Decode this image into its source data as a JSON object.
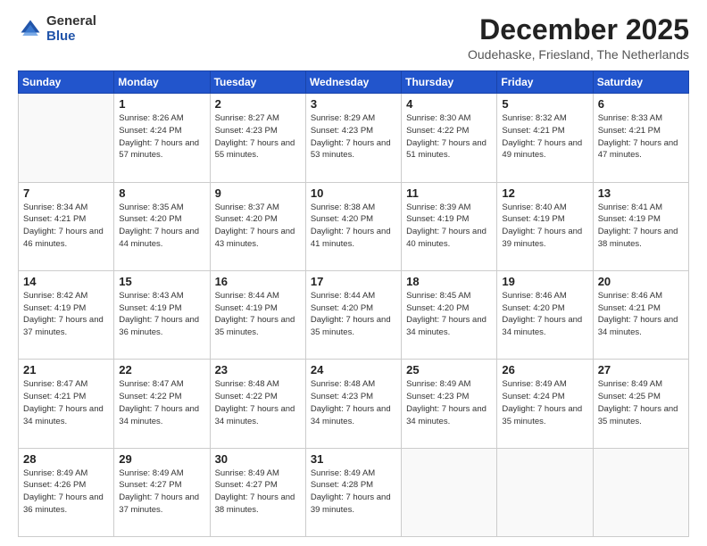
{
  "logo": {
    "general": "General",
    "blue": "Blue"
  },
  "header": {
    "month": "December 2025",
    "location": "Oudehaske, Friesland, The Netherlands"
  },
  "days": [
    "Sunday",
    "Monday",
    "Tuesday",
    "Wednesday",
    "Thursday",
    "Friday",
    "Saturday"
  ],
  "weeks": [
    [
      {
        "day": "",
        "sunrise": "",
        "sunset": "",
        "daylight": ""
      },
      {
        "day": "1",
        "sunrise": "Sunrise: 8:26 AM",
        "sunset": "Sunset: 4:24 PM",
        "daylight": "Daylight: 7 hours and 57 minutes."
      },
      {
        "day": "2",
        "sunrise": "Sunrise: 8:27 AM",
        "sunset": "Sunset: 4:23 PM",
        "daylight": "Daylight: 7 hours and 55 minutes."
      },
      {
        "day": "3",
        "sunrise": "Sunrise: 8:29 AM",
        "sunset": "Sunset: 4:23 PM",
        "daylight": "Daylight: 7 hours and 53 minutes."
      },
      {
        "day": "4",
        "sunrise": "Sunrise: 8:30 AM",
        "sunset": "Sunset: 4:22 PM",
        "daylight": "Daylight: 7 hours and 51 minutes."
      },
      {
        "day": "5",
        "sunrise": "Sunrise: 8:32 AM",
        "sunset": "Sunset: 4:21 PM",
        "daylight": "Daylight: 7 hours and 49 minutes."
      },
      {
        "day": "6",
        "sunrise": "Sunrise: 8:33 AM",
        "sunset": "Sunset: 4:21 PM",
        "daylight": "Daylight: 7 hours and 47 minutes."
      }
    ],
    [
      {
        "day": "7",
        "sunrise": "Sunrise: 8:34 AM",
        "sunset": "Sunset: 4:21 PM",
        "daylight": "Daylight: 7 hours and 46 minutes."
      },
      {
        "day": "8",
        "sunrise": "Sunrise: 8:35 AM",
        "sunset": "Sunset: 4:20 PM",
        "daylight": "Daylight: 7 hours and 44 minutes."
      },
      {
        "day": "9",
        "sunrise": "Sunrise: 8:37 AM",
        "sunset": "Sunset: 4:20 PM",
        "daylight": "Daylight: 7 hours and 43 minutes."
      },
      {
        "day": "10",
        "sunrise": "Sunrise: 8:38 AM",
        "sunset": "Sunset: 4:20 PM",
        "daylight": "Daylight: 7 hours and 41 minutes."
      },
      {
        "day": "11",
        "sunrise": "Sunrise: 8:39 AM",
        "sunset": "Sunset: 4:19 PM",
        "daylight": "Daylight: 7 hours and 40 minutes."
      },
      {
        "day": "12",
        "sunrise": "Sunrise: 8:40 AM",
        "sunset": "Sunset: 4:19 PM",
        "daylight": "Daylight: 7 hours and 39 minutes."
      },
      {
        "day": "13",
        "sunrise": "Sunrise: 8:41 AM",
        "sunset": "Sunset: 4:19 PM",
        "daylight": "Daylight: 7 hours and 38 minutes."
      }
    ],
    [
      {
        "day": "14",
        "sunrise": "Sunrise: 8:42 AM",
        "sunset": "Sunset: 4:19 PM",
        "daylight": "Daylight: 7 hours and 37 minutes."
      },
      {
        "day": "15",
        "sunrise": "Sunrise: 8:43 AM",
        "sunset": "Sunset: 4:19 PM",
        "daylight": "Daylight: 7 hours and 36 minutes."
      },
      {
        "day": "16",
        "sunrise": "Sunrise: 8:44 AM",
        "sunset": "Sunset: 4:19 PM",
        "daylight": "Daylight: 7 hours and 35 minutes."
      },
      {
        "day": "17",
        "sunrise": "Sunrise: 8:44 AM",
        "sunset": "Sunset: 4:20 PM",
        "daylight": "Daylight: 7 hours and 35 minutes."
      },
      {
        "day": "18",
        "sunrise": "Sunrise: 8:45 AM",
        "sunset": "Sunset: 4:20 PM",
        "daylight": "Daylight: 7 hours and 34 minutes."
      },
      {
        "day": "19",
        "sunrise": "Sunrise: 8:46 AM",
        "sunset": "Sunset: 4:20 PM",
        "daylight": "Daylight: 7 hours and 34 minutes."
      },
      {
        "day": "20",
        "sunrise": "Sunrise: 8:46 AM",
        "sunset": "Sunset: 4:21 PM",
        "daylight": "Daylight: 7 hours and 34 minutes."
      }
    ],
    [
      {
        "day": "21",
        "sunrise": "Sunrise: 8:47 AM",
        "sunset": "Sunset: 4:21 PM",
        "daylight": "Daylight: 7 hours and 34 minutes."
      },
      {
        "day": "22",
        "sunrise": "Sunrise: 8:47 AM",
        "sunset": "Sunset: 4:22 PM",
        "daylight": "Daylight: 7 hours and 34 minutes."
      },
      {
        "day": "23",
        "sunrise": "Sunrise: 8:48 AM",
        "sunset": "Sunset: 4:22 PM",
        "daylight": "Daylight: 7 hours and 34 minutes."
      },
      {
        "day": "24",
        "sunrise": "Sunrise: 8:48 AM",
        "sunset": "Sunset: 4:23 PM",
        "daylight": "Daylight: 7 hours and 34 minutes."
      },
      {
        "day": "25",
        "sunrise": "Sunrise: 8:49 AM",
        "sunset": "Sunset: 4:23 PM",
        "daylight": "Daylight: 7 hours and 34 minutes."
      },
      {
        "day": "26",
        "sunrise": "Sunrise: 8:49 AM",
        "sunset": "Sunset: 4:24 PM",
        "daylight": "Daylight: 7 hours and 35 minutes."
      },
      {
        "day": "27",
        "sunrise": "Sunrise: 8:49 AM",
        "sunset": "Sunset: 4:25 PM",
        "daylight": "Daylight: 7 hours and 35 minutes."
      }
    ],
    [
      {
        "day": "28",
        "sunrise": "Sunrise: 8:49 AM",
        "sunset": "Sunset: 4:26 PM",
        "daylight": "Daylight: 7 hours and 36 minutes."
      },
      {
        "day": "29",
        "sunrise": "Sunrise: 8:49 AM",
        "sunset": "Sunset: 4:27 PM",
        "daylight": "Daylight: 7 hours and 37 minutes."
      },
      {
        "day": "30",
        "sunrise": "Sunrise: 8:49 AM",
        "sunset": "Sunset: 4:27 PM",
        "daylight": "Daylight: 7 hours and 38 minutes."
      },
      {
        "day": "31",
        "sunrise": "Sunrise: 8:49 AM",
        "sunset": "Sunset: 4:28 PM",
        "daylight": "Daylight: 7 hours and 39 minutes."
      },
      {
        "day": "",
        "sunrise": "",
        "sunset": "",
        "daylight": ""
      },
      {
        "day": "",
        "sunrise": "",
        "sunset": "",
        "daylight": ""
      },
      {
        "day": "",
        "sunrise": "",
        "sunset": "",
        "daylight": ""
      }
    ]
  ]
}
